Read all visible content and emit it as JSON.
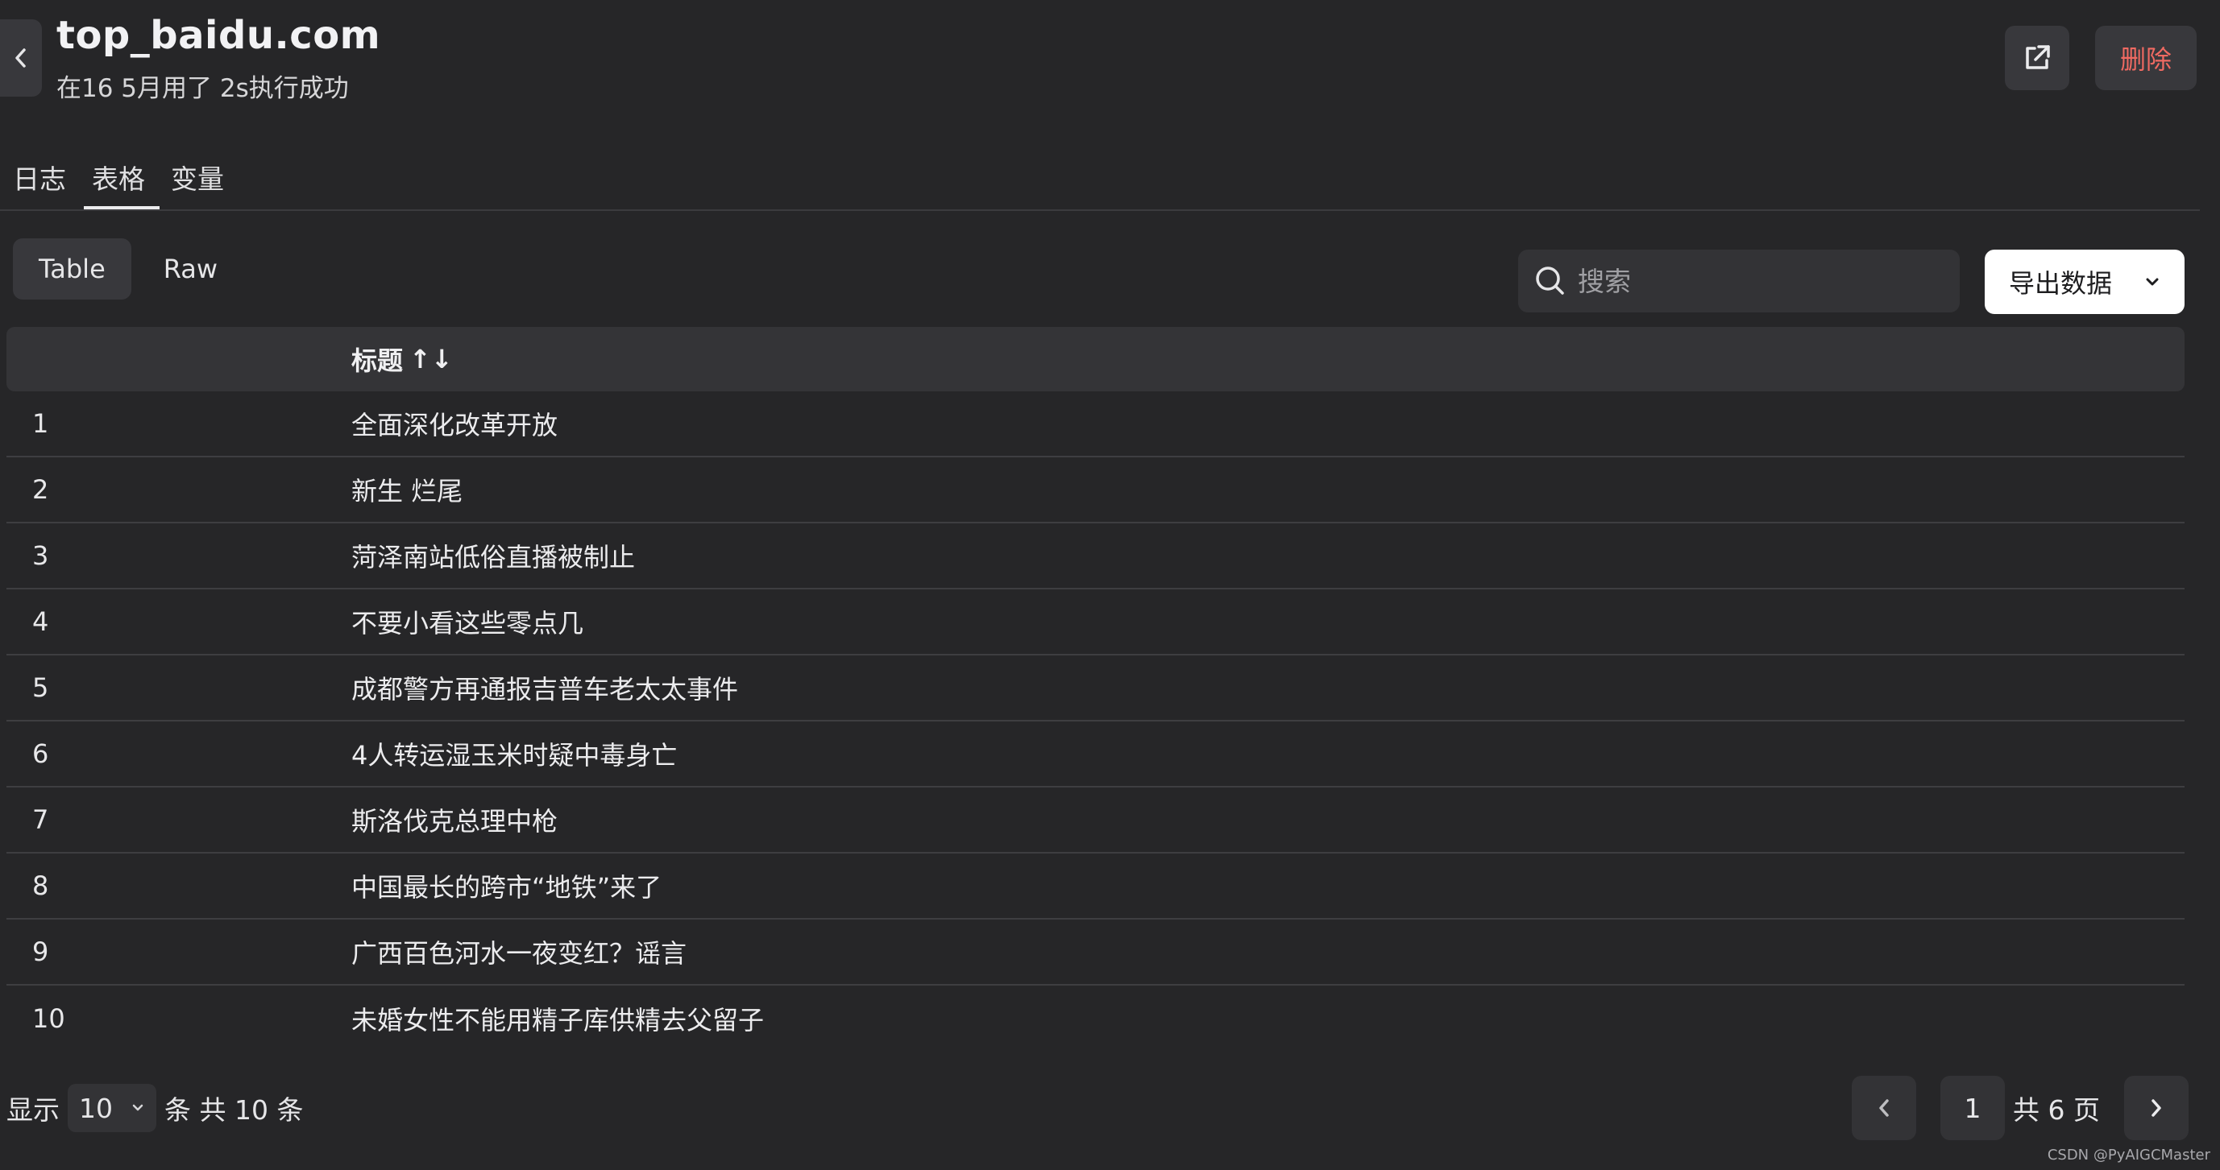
{
  "header": {
    "title": "top_baidu.com",
    "subtitle": "在16 5月用了 2s执行成功",
    "delete_label": "删除"
  },
  "tabs": [
    {
      "label": "日志"
    },
    {
      "label": "表格"
    },
    {
      "label": "变量"
    }
  ],
  "view_toggle": [
    {
      "label": "Table"
    },
    {
      "label": "Raw"
    }
  ],
  "search": {
    "placeholder": "搜索"
  },
  "export": {
    "label": "导出数据"
  },
  "table": {
    "header": {
      "title": "标题",
      "sort_icon": "↑↓"
    },
    "rows": [
      {
        "index": "1",
        "title": "全面深化改革开放"
      },
      {
        "index": "2",
        "title": "新生 烂尾"
      },
      {
        "index": "3",
        "title": "菏泽南站低俗直播被制止"
      },
      {
        "index": "4",
        "title": "不要小看这些零点几"
      },
      {
        "index": "5",
        "title": "成都警方再通报吉普车老太太事件"
      },
      {
        "index": "6",
        "title": "4人转运湿玉米时疑中毒身亡"
      },
      {
        "index": "7",
        "title": "斯洛伐克总理中枪"
      },
      {
        "index": "8",
        "title": "中国最长的跨市“地铁”来了"
      },
      {
        "index": "9",
        "title": "广西百色河水一夜变红？谣言"
      },
      {
        "index": "10",
        "title": "未婚女性不能用精子库供精去父留子"
      }
    ]
  },
  "footer": {
    "show_label": "显示",
    "page_size": "10",
    "count_text": "条 共 10 条",
    "current_page": "1",
    "total_pages_text": "共 6 页"
  },
  "watermark": "CSDN @PyAIGCMaster"
}
